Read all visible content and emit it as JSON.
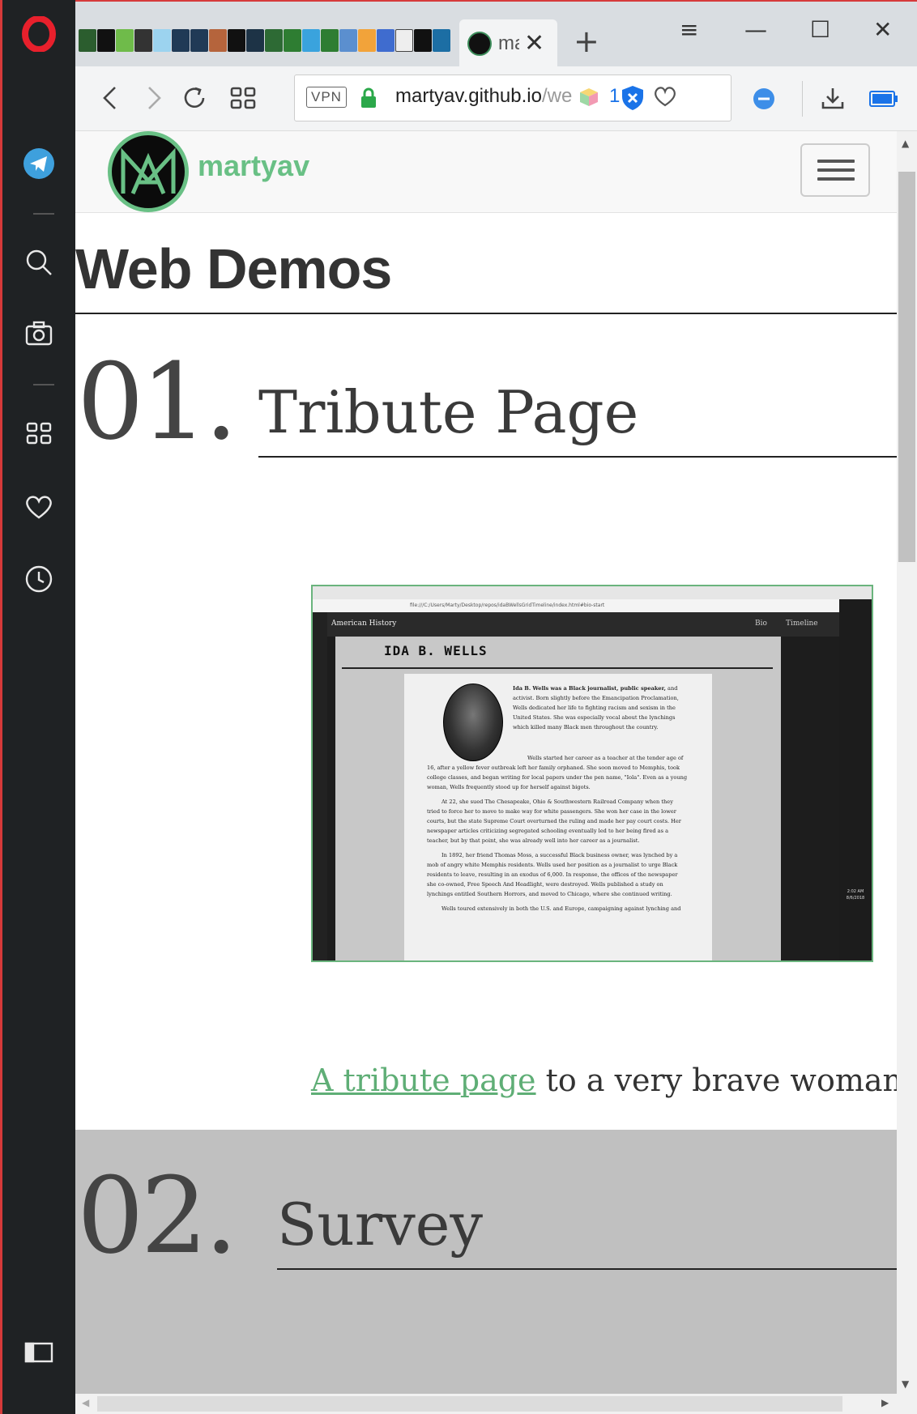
{
  "browser": {
    "tab": {
      "title": "ma",
      "close_glyph": "✕"
    },
    "new_tab_glyph": "+",
    "window_controls": {
      "menu": "≡",
      "minimize": "—",
      "maximize": "☐",
      "close": "✕"
    },
    "address_bar": {
      "vpn_label": "VPN",
      "url_host": "martyav.github.io",
      "url_path": "/we",
      "extension_count": "1"
    },
    "sidebar_icons": [
      "opera-logo-icon",
      "telegram-icon",
      "search-icon",
      "camera-icon",
      "speed-dial-icon",
      "heart-icon",
      "history-icon",
      "sidebar-toggle-icon"
    ]
  },
  "site": {
    "name": "martyav",
    "colors": {
      "brand_green": "#69c085",
      "section_gray": "#c0c0c0",
      "text": "#333333"
    }
  },
  "page": {
    "title": "Web Demos",
    "projects": [
      {
        "number": "01.",
        "name": "Tribute Page",
        "link_text": "A tribute page",
        "caption_rest": " to a very brave woman",
        "screenshot": {
          "header": "American History",
          "nav": [
            "Bio",
            "Timeline"
          ],
          "heading": "IDA B. WELLS",
          "intro_bold": "Ida B. Wells was a Black journalist, public speaker,",
          "intro": "and activist. Born slightly before the Emancipation Proclamation, Wells dedicated her life to fighting racism and sexism in the United States. She was especially vocal about the lynchings which killed many Black men throughout the country.",
          "paragraphs": [
            "Wells started her career as a teacher at the tender age of 16, after a yellow fever outbreak left her family orphaned. She soon moved to Memphis, took college classes, and began writing for local papers under the pen name, \"Iola\". Even as a young woman, Wells frequently stood up for herself against bigots.",
            "At 22, she sued The Chesapeake, Ohio & Southwestern Railroad Company when they tried to force her to move to make way for white passengers. She won her case in the lower courts, but the state Supreme Court overturned the ruling and made her pay court costs. Her newspaper articles criticizing segregated schooling eventually led to her being fired as a teacher, but by that point, she was already well into her career as a journalist.",
            "In 1892, her friend Thomas Moss, a successful Black business owner, was lynched by a mob of angry white Memphis residents. Wells used her position as a journalist to urge Black residents to leave, resulting in an exodus of 6,000. In response, the offices of the newspaper she co-owned, Free Speech And Headlight, were destroyed. Wells published a study on lynchings entitled Southern Horrors, and moved to Chicago, where she continued writing.",
            "Wells toured extensively in both the U.S. and Europe, campaigning against lynching and"
          ],
          "address": "file:///C:/Users/Marty/Desktop/repos/idaBWellsGridTimeline/index.html#bio-start",
          "clock_time": "2:02 AM",
          "clock_date": "8/6/2018"
        }
      },
      {
        "number": "02.",
        "name": "Survey"
      }
    ]
  }
}
